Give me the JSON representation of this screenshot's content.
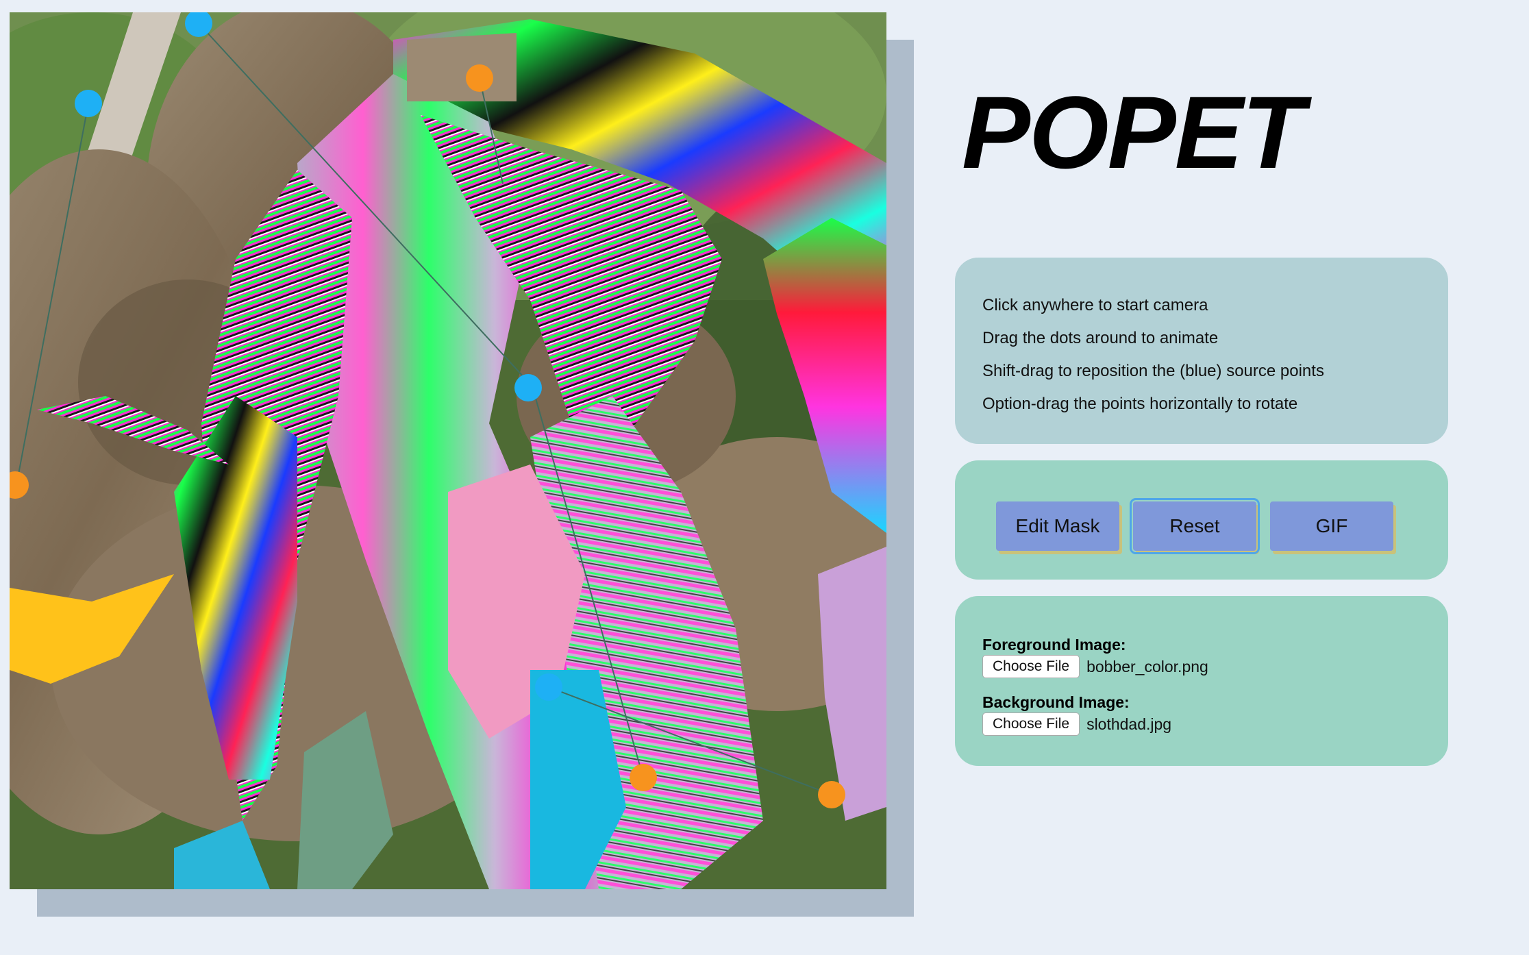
{
  "app": {
    "title": "POPET"
  },
  "instructions": [
    "Click anywhere to start camera",
    "Drag the dots around to animate",
    "Shift-drag to reposition the (blue) source points",
    "Option-drag the points horizontally to rotate"
  ],
  "buttons": {
    "edit_mask": "Edit Mask",
    "reset": "Reset",
    "gif": "GIF"
  },
  "files": {
    "foreground": {
      "label": "Foreground Image:",
      "button": "Choose File",
      "filename": "bobber_color.png"
    },
    "background": {
      "label": "Background Image:",
      "button": "Choose File",
      "filename": "slothdad.jpg"
    }
  },
  "colors": {
    "page_bg": "#e9eff7",
    "instructions_card": "#b2d1d6",
    "controls_card": "#9ad4c4",
    "button": "#7f98da",
    "source_point": "#1eb0f5",
    "target_point": "#f7931e"
  }
}
